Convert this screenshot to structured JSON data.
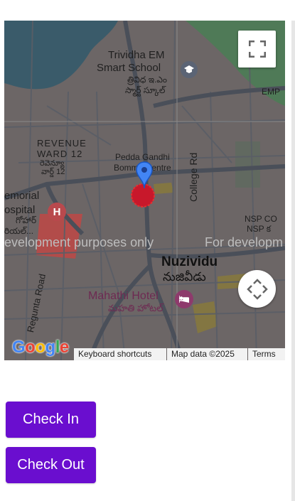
{
  "map": {
    "labels": {
      "trividha_en": "Trividha EM",
      "smart_school": "Smart School",
      "trividha_te": "త్రివిధ ఇ.ఎం",
      "smart_school_te": "స్మార్ట్ స్కూల్",
      "emp": "EMP",
      "revenue": "REVENUE",
      "ward12": "WARD 12",
      "ward12_te": "రెవెన్యూ",
      "ward12_te2": "వార్డ్ 12",
      "pedda": "Pedda Gandhi",
      "bomma": "Bomma Centre",
      "memorial": "emorial",
      "hospital": "ospital",
      "hospital_te": "గోహార్",
      "hospital_te2": "రియల్...",
      "college_rd": "College Rd",
      "nsp1": "NSP CO",
      "nsp2": "NSP క",
      "dev_left": "evelopment purposes only",
      "dev_right": "For developm",
      "nuzividu": "Nuzividu",
      "nuzividu_te": "నుజివీడు",
      "regunta": "Regunta Road",
      "mahathi": "Mahathi Hotel",
      "mahathi_te": "మహతి హోటల్",
      "google": "Google"
    },
    "attribution": {
      "keyboard": "Keyboard shortcuts",
      "mapdata": "Map data ©2025",
      "terms": "Terms"
    },
    "icons": {
      "fullscreen": "fullscreen-icon",
      "pan": "pan-arrows-icon",
      "marker": "location-pin-icon",
      "hospital": "hospital-icon",
      "school": "school-icon",
      "hotel": "hotel-icon"
    }
  },
  "actions": {
    "check_in": "Check In",
    "check_out": "Check Out"
  },
  "colors": {
    "button": "#6a0ecf",
    "map_overlay": "#6c6666",
    "marker": "#4285f4"
  }
}
